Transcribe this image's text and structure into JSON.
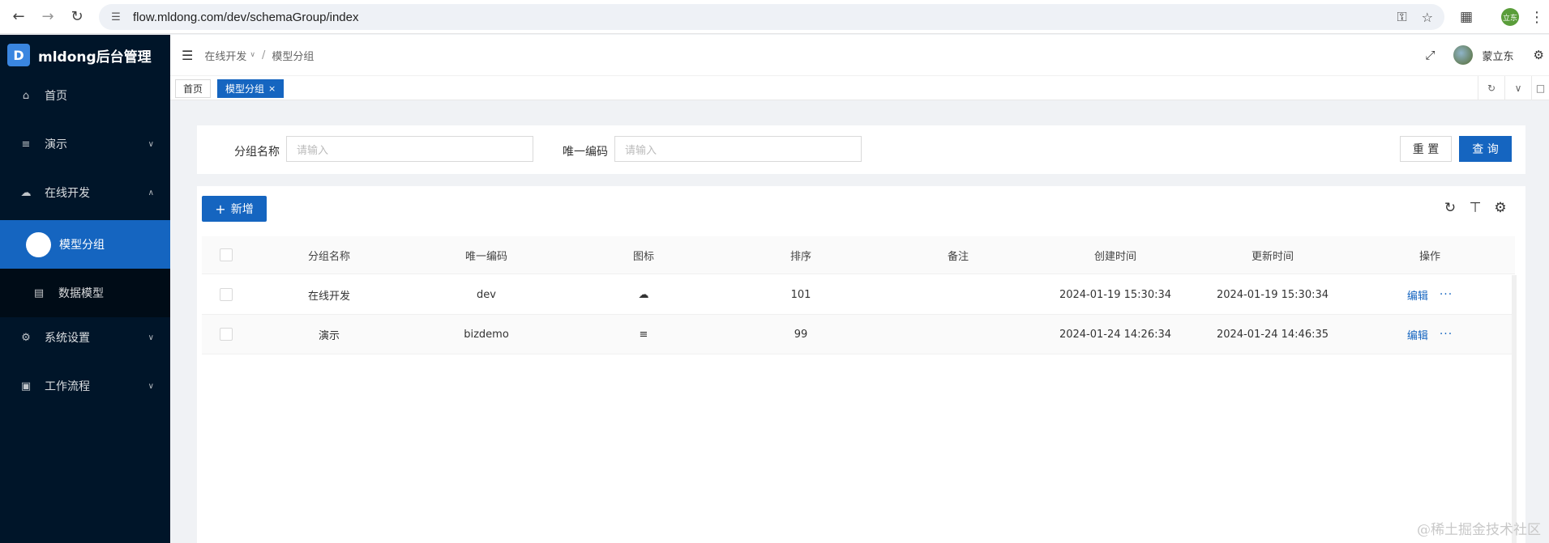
{
  "browser": {
    "url": "flow.mldong.com/dev/schemaGroup/index",
    "profile_label": "立东"
  },
  "sidebar": {
    "logo_mark": "D",
    "app_title": "mldong后台管理",
    "items": [
      {
        "label": "首页",
        "icon": "home-icon"
      },
      {
        "label": "演示",
        "icon": "align-center-icon"
      },
      {
        "label": "在线开发",
        "icon": "cloud-icon"
      },
      {
        "label": "模型分组",
        "icon": "circle-icon"
      },
      {
        "label": "数据模型",
        "icon": "database-icon"
      },
      {
        "label": "系统设置",
        "icon": "gear-icon"
      },
      {
        "label": "工作流程",
        "icon": "laptop-icon"
      }
    ]
  },
  "header": {
    "breadcrumb": [
      "在线开发",
      "模型分组"
    ],
    "username": "蒙立东"
  },
  "tabs": [
    {
      "label": "首页",
      "active": false
    },
    {
      "label": "模型分组",
      "active": true,
      "close": "×"
    }
  ],
  "search": {
    "fields": [
      {
        "label": "分组名称",
        "placeholder": "请输入"
      },
      {
        "label": "唯一编码",
        "placeholder": "请输入"
      }
    ],
    "reset_label": "重 置",
    "query_label": "查 询"
  },
  "table": {
    "add_label": "新增",
    "columns": [
      "分组名称",
      "唯一编码",
      "图标",
      "排序",
      "备注",
      "创建时间",
      "更新时间",
      "操作"
    ],
    "rows": [
      {
        "name": "在线开发",
        "code": "dev",
        "icon": "cloud-icon",
        "sort": "101",
        "remark": "",
        "created": "2024-01-19 15:30:34",
        "updated": "2024-01-19 15:30:34",
        "action": "编辑",
        "more": "···"
      },
      {
        "name": "演示",
        "code": "bizdemo",
        "icon": "align-center-icon",
        "sort": "99",
        "remark": "",
        "created": "2024-01-24 14:26:34",
        "updated": "2024-01-24 14:46:35",
        "action": "编辑",
        "more": "···"
      }
    ]
  },
  "watermark": "@稀土掘金技术社区",
  "colors": {
    "sidebar_bg": "#001529",
    "primary": "#1565c0",
    "page_bg": "#f0f2f5"
  }
}
